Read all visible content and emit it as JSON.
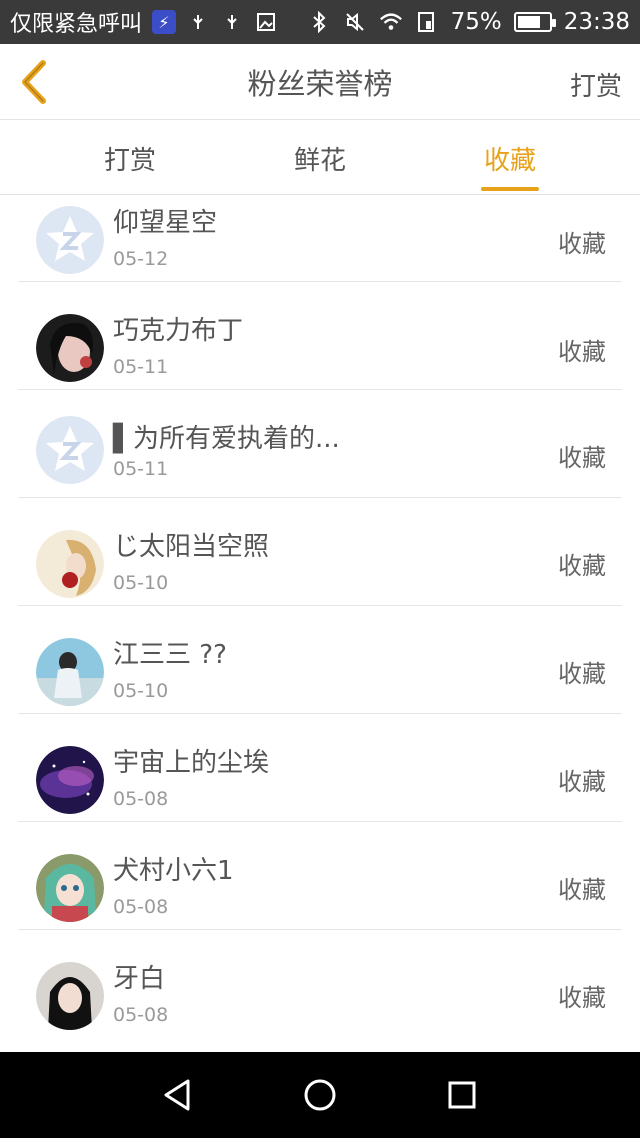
{
  "status_bar": {
    "carrier": "仅限紧急呼叫",
    "battery": "75%",
    "battery_level": 0.75,
    "time": "23:38",
    "icons": [
      "charging-bolt-icon",
      "usb-icon",
      "usb-icon",
      "image-icon",
      "bluetooth-icon",
      "mute-icon",
      "wifi-icon",
      "sim-icon",
      "battery-icon"
    ]
  },
  "header": {
    "title": "粉丝荣誉榜",
    "action": "打赏",
    "back_icon": "chevron-left-icon"
  },
  "tabs": [
    {
      "label": "打赏",
      "active": false
    },
    {
      "label": "鲜花",
      "active": false
    },
    {
      "label": "收藏",
      "active": true
    }
  ],
  "list": [
    {
      "name": "仰望星空",
      "date": "05-12",
      "action": "收藏",
      "avatar": "default-star-avatar"
    },
    {
      "name": "巧克力布丁",
      "date": "05-11",
      "action": "收藏",
      "avatar": "photo-avatar"
    },
    {
      "name": "▌为所有爱执着的...",
      "date": "05-11",
      "action": "收藏",
      "avatar": "default-star-avatar"
    },
    {
      "name": "じ太阳当空照",
      "date": "05-10",
      "action": "收藏",
      "avatar": "photo-avatar"
    },
    {
      "name": "江三三 ??",
      "date": "05-10",
      "action": "收藏",
      "avatar": "photo-avatar"
    },
    {
      "name": "宇宙上的尘埃",
      "date": "05-08",
      "action": "收藏",
      "avatar": "galaxy-avatar"
    },
    {
      "name": "犬村小六1",
      "date": "05-08",
      "action": "收藏",
      "avatar": "anime-avatar"
    },
    {
      "name": "牙白",
      "date": "05-08",
      "action": "收藏",
      "avatar": "photo-avatar"
    }
  ],
  "colors": {
    "accent": "#e8a21a",
    "status_bar": "#3a3a3a",
    "nav_bar": "#000000"
  },
  "nav_bar": {
    "icons": [
      "back-triangle-icon",
      "home-circle-icon",
      "recents-square-icon"
    ]
  }
}
